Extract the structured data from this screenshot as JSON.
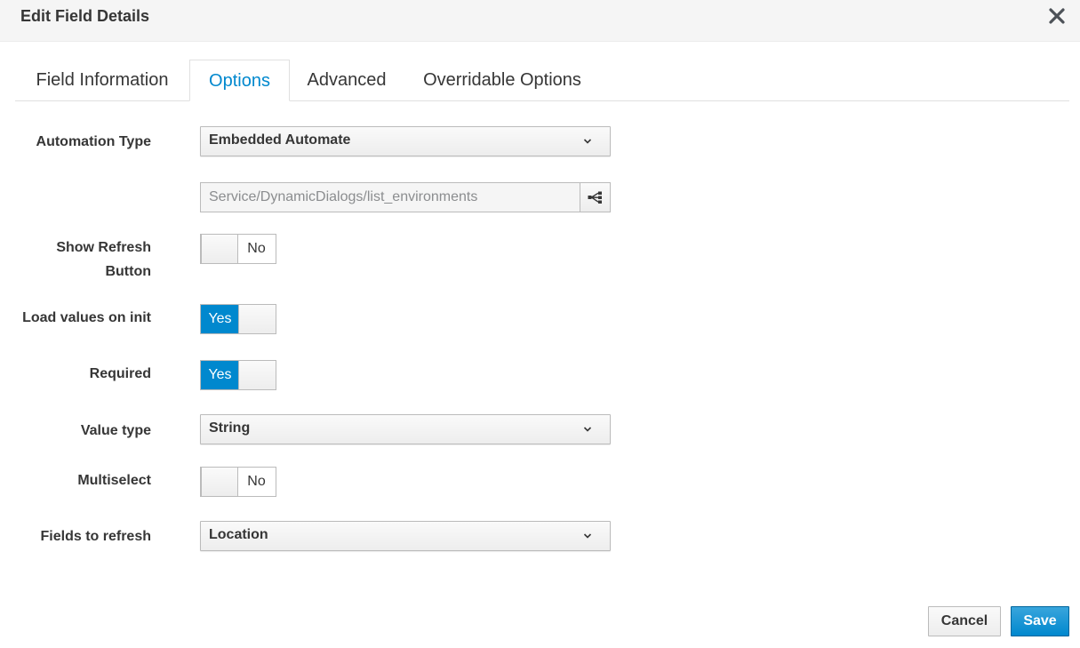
{
  "dialog": {
    "title": "Edit Field Details",
    "close_icon": "close-icon"
  },
  "tabs": [
    {
      "label": "Field Information",
      "active": false
    },
    {
      "label": "Options",
      "active": true
    },
    {
      "label": "Advanced",
      "active": false
    },
    {
      "label": "Overridable Options",
      "active": false
    }
  ],
  "form": {
    "automation_type": {
      "label": "Automation Type",
      "value": "Embedded Automate"
    },
    "entry_point": {
      "value": "Service/DynamicDialogs/list_environments",
      "icon": "sitemap-icon"
    },
    "show_refresh": {
      "label_line1": "Show Refresh",
      "label_line2": "Button",
      "state": "No"
    },
    "load_values_on_init": {
      "label": "Load values on init",
      "state": "Yes"
    },
    "required": {
      "label": "Required",
      "state": "Yes"
    },
    "value_type": {
      "label": "Value type",
      "value": "String"
    },
    "multiselect": {
      "label": "Multiselect",
      "state": "No"
    },
    "fields_to_refresh": {
      "label": "Fields to refresh",
      "value": "Location"
    }
  },
  "footer": {
    "cancel_label": "Cancel",
    "save_label": "Save"
  },
  "colors": {
    "accent": "#0088ce",
    "header_bg": "#f5f5f5"
  }
}
